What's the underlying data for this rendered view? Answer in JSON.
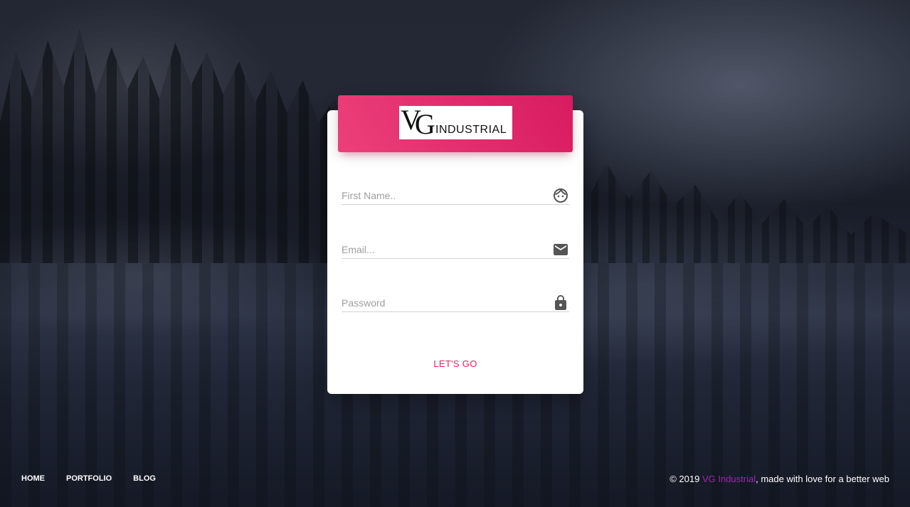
{
  "brand": {
    "logo_mark": "VG",
    "logo_text": "INDUSTRIAL",
    "accent_color": "#e91e63",
    "header_gradient": [
      "#ec407a",
      "#d81b60"
    ],
    "link_color": "#9c27b0"
  },
  "form": {
    "first_name": {
      "placeholder": "First Name..",
      "value": "",
      "icon": "face-icon"
    },
    "email": {
      "placeholder": "Email...",
      "value": "",
      "icon": "mail-icon"
    },
    "password": {
      "placeholder": "Password",
      "value": "",
      "icon": "lock-icon"
    },
    "submit_label": "LET'S GO"
  },
  "footer": {
    "nav": [
      {
        "label": "HOME"
      },
      {
        "label": "PORTFOLIO"
      },
      {
        "label": "BLOG"
      }
    ],
    "copyright_prefix": "© 2019 ",
    "copyright_link": "VG Industrial",
    "copyright_suffix": ", made with love for a better web"
  }
}
